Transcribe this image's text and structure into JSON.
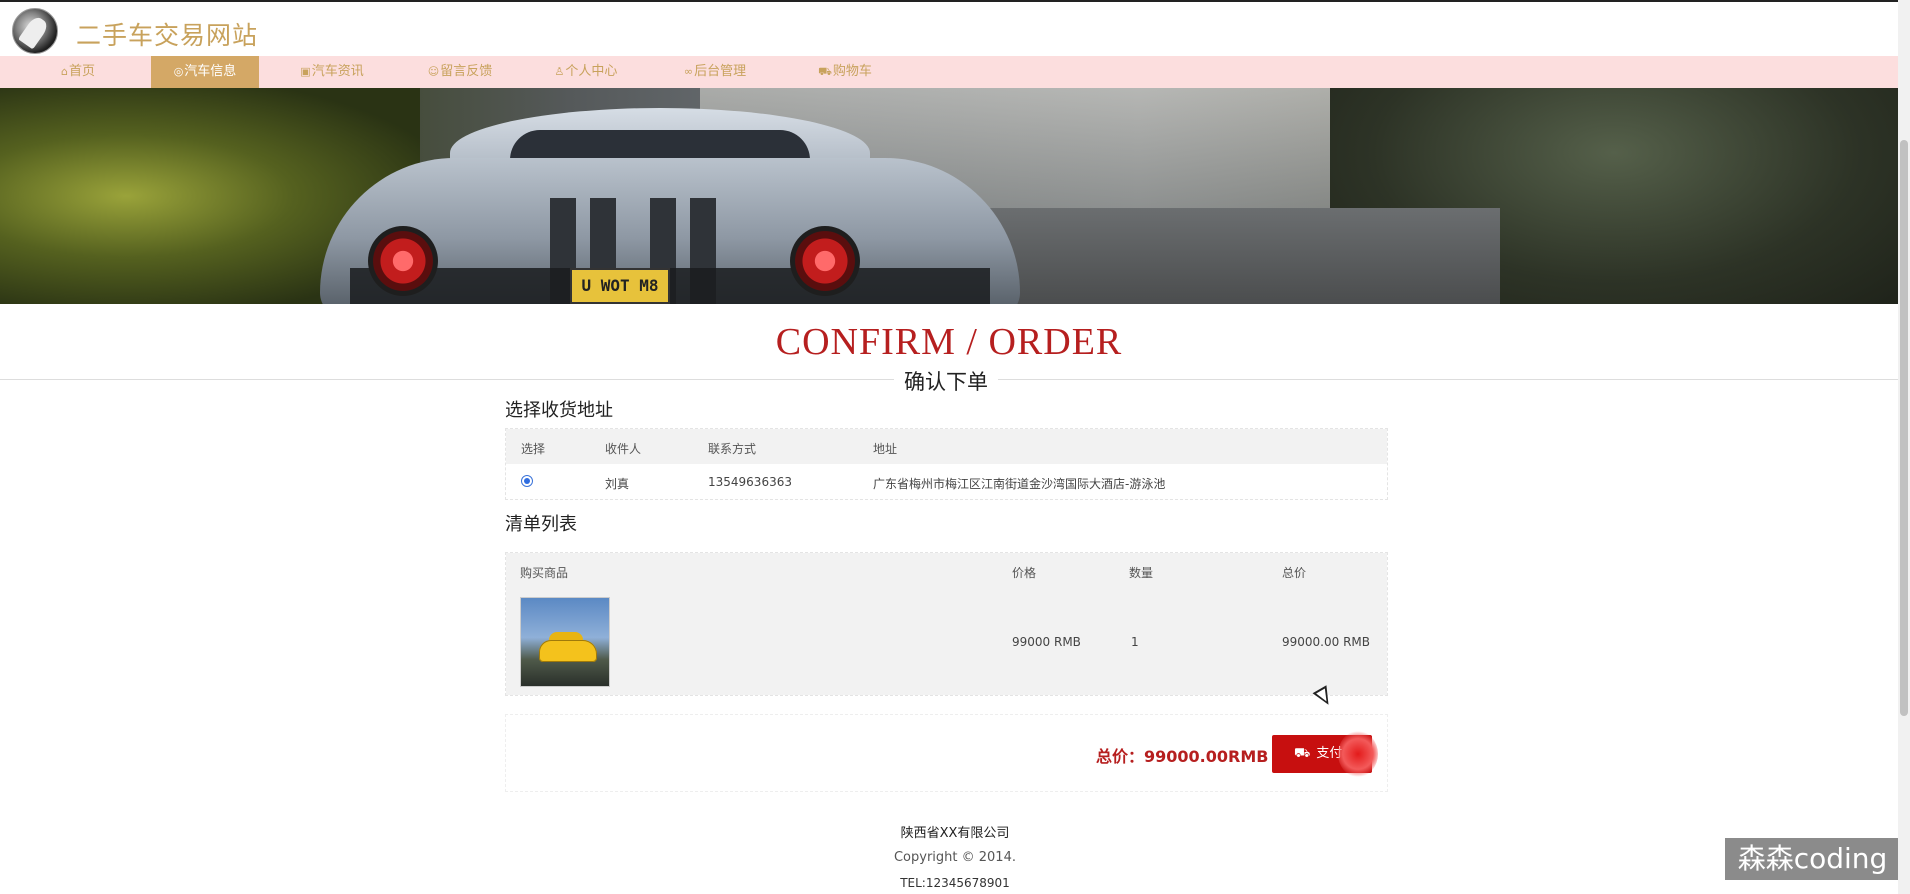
{
  "header": {
    "site_title": "二手车交易网站"
  },
  "nav": {
    "items": [
      {
        "icon": "home-icon",
        "glyph": "⌂",
        "label": "首页"
      },
      {
        "icon": "car-icon",
        "glyph": "◎",
        "label": "汽车信息"
      },
      {
        "icon": "news-icon",
        "glyph": "▣",
        "label": "汽车资讯"
      },
      {
        "icon": "message-icon",
        "glyph": "☺",
        "label": "留言反馈"
      },
      {
        "icon": "user-icon",
        "glyph": "♙",
        "label": "个人中心"
      },
      {
        "icon": "link-icon",
        "glyph": "∞",
        "label": "后台管理"
      },
      {
        "icon": "cart-icon",
        "glyph": "⛟",
        "label": "购物车"
      }
    ],
    "active_index": 1
  },
  "banner": {
    "plate_text": "U WOT M8"
  },
  "confirm": {
    "title": "CONFIRM / ORDER",
    "subtitle": "确认下单"
  },
  "address_section": {
    "title": "选择收货地址",
    "headers": {
      "select": "选择",
      "receiver": "收件人",
      "contact": "联系方式",
      "address": "地址"
    },
    "rows": [
      {
        "receiver": "刘真",
        "contact": "13549636363",
        "address": "广东省梅州市梅江区江南街道金沙湾国际大酒店-游泳池",
        "selected": true
      }
    ]
  },
  "cart_section": {
    "title": "清单列表",
    "headers": {
      "product": "购买商品",
      "price": "价格",
      "qty": "数量",
      "total": "总价"
    },
    "rows": [
      {
        "price": "99000 RMB",
        "qty": "1",
        "total": "99000.00 RMB"
      }
    ]
  },
  "summary": {
    "total_text": "总价：99000.00RMB",
    "pay_label": "支付"
  },
  "footer": {
    "company": "陕西省XX有限公司",
    "copyright": "Copyright © 2014.",
    "tel": "TEL:12345678901"
  },
  "watermark": "森森coding",
  "colors": {
    "nav_bg": "#fcdede",
    "nav_active": "#d4a866",
    "brand_gold": "#c8a25c",
    "accent_red": "#b61f1f",
    "button_red": "#c70f0f"
  }
}
